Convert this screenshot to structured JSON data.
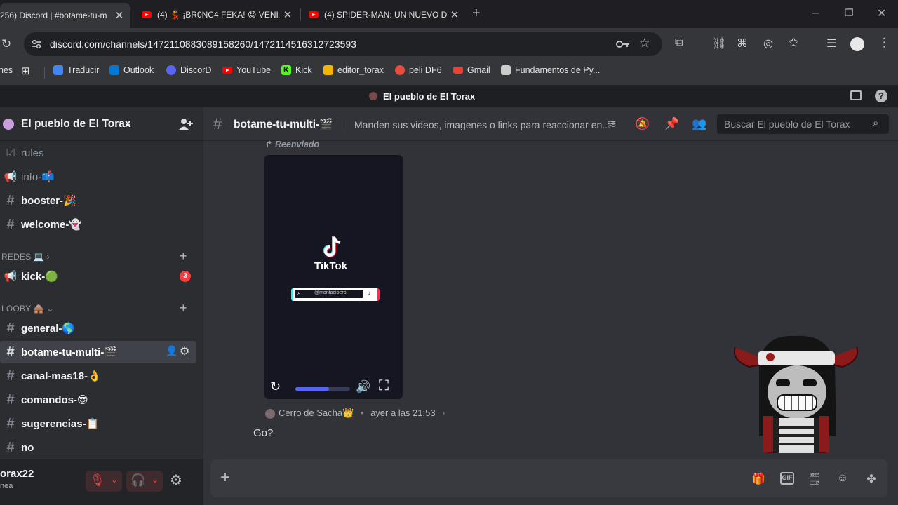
{
  "browser": {
    "tabs": [
      {
        "title": "256) Discord | #botame-tu-m",
        "active": true
      },
      {
        "title": "(4) 💃 ¡BR0NC4 FEKA! 😡 VENI",
        "active": false
      },
      {
        "title": "(4) SPIDER-MAN: UN NUEVO D",
        "active": false
      }
    ],
    "url": "discord.com/channels/1472110883089158260/1472114516312723593",
    "bookmarks": [
      {
        "label": "nes",
        "icon": "apps-icon",
        "color": "#35363a"
      },
      {
        "label": "Traducir",
        "icon": "translate-icon",
        "color": "#4285f4"
      },
      {
        "label": "Outlook",
        "icon": "outlook-icon",
        "color": "#0078d4"
      },
      {
        "label": "DiscorD",
        "icon": "discord-icon",
        "color": "#5865f2"
      },
      {
        "label": "YouTube",
        "icon": "youtube-icon",
        "color": "#ff0000"
      },
      {
        "label": "Kick",
        "icon": "kick-icon",
        "color": "#53fc18"
      },
      {
        "label": "editor_torax",
        "icon": "editor-icon",
        "color": "#f4b400"
      },
      {
        "label": "peli DF6",
        "icon": "peli-icon",
        "color": "#e74c3c"
      },
      {
        "label": "Gmail",
        "icon": "gmail-icon",
        "color": "#ea4335"
      },
      {
        "label": "Fundamentos de Py...",
        "icon": "doc-icon",
        "color": "#cccccc"
      }
    ]
  },
  "window_title": "El pueblo de El Torax",
  "server": {
    "name": "El pueblo de El Torax",
    "channels": [
      {
        "name": "rules",
        "icon": "rules-icon",
        "style": "dim"
      },
      {
        "name": "info-📫",
        "icon": "announce-icon",
        "style": "dim"
      },
      {
        "name": "booster-🎉",
        "icon": "#",
        "style": "bright"
      },
      {
        "name": "welcome-👻",
        "icon": "#",
        "style": "bright"
      }
    ],
    "categories": [
      {
        "label": "REDES 💻",
        "channels": [
          {
            "name": "kick-🟢",
            "icon": "announce-icon",
            "badge": "3"
          }
        ]
      },
      {
        "label": "LOOBY 🛖",
        "channels": [
          {
            "name": "general-🌎",
            "icon": "#"
          },
          {
            "name": "botame-tu-multi-🎬",
            "icon": "#",
            "selected": true
          },
          {
            "name": "canal-mas18-👌",
            "icon": "#"
          },
          {
            "name": "comandos-😎",
            "icon": "#"
          },
          {
            "name": "sugerencias-📋",
            "icon": "#"
          },
          {
            "name": "no",
            "icon": "#"
          }
        ]
      }
    ]
  },
  "user": {
    "name": "orax22",
    "status": "nea"
  },
  "channel": {
    "name": "botame-tu-multi-🎬",
    "topic": "Manden sus videos, imagenes o links para reaccionar en...",
    "search_placeholder": "Buscar El pueblo de El Torax"
  },
  "messages": {
    "forwarded_label": "Reenviado",
    "video": {
      "app_name": "TikTok",
      "search_text": "@montacipero",
      "progress": 0.62
    },
    "reply": {
      "author": "Cerro de Sacha👑",
      "timestamp": "ayer a las 21:53",
      "text": "Go?"
    }
  }
}
